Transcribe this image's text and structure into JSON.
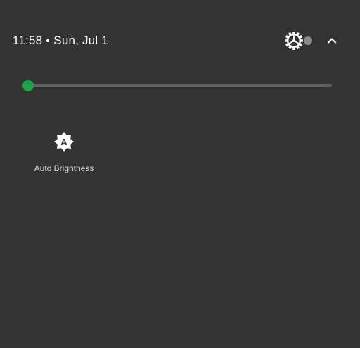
{
  "status_bar": {
    "time": "11:58",
    "date": "Sun, Jul 1"
  },
  "icons": {
    "settings": "gear-icon",
    "collapse": "chevron-up-icon",
    "tile": "auto-brightness-icon"
  },
  "brightness": {
    "level": 0.0
  },
  "tiles": {
    "auto_brightness": {
      "label": "Auto Brightness",
      "glyph": "A"
    }
  },
  "colors": {
    "background": "#333333",
    "slider_accent": "#1fa34a",
    "slider_track": "#5f5f5f",
    "text": "#ffffff"
  }
}
